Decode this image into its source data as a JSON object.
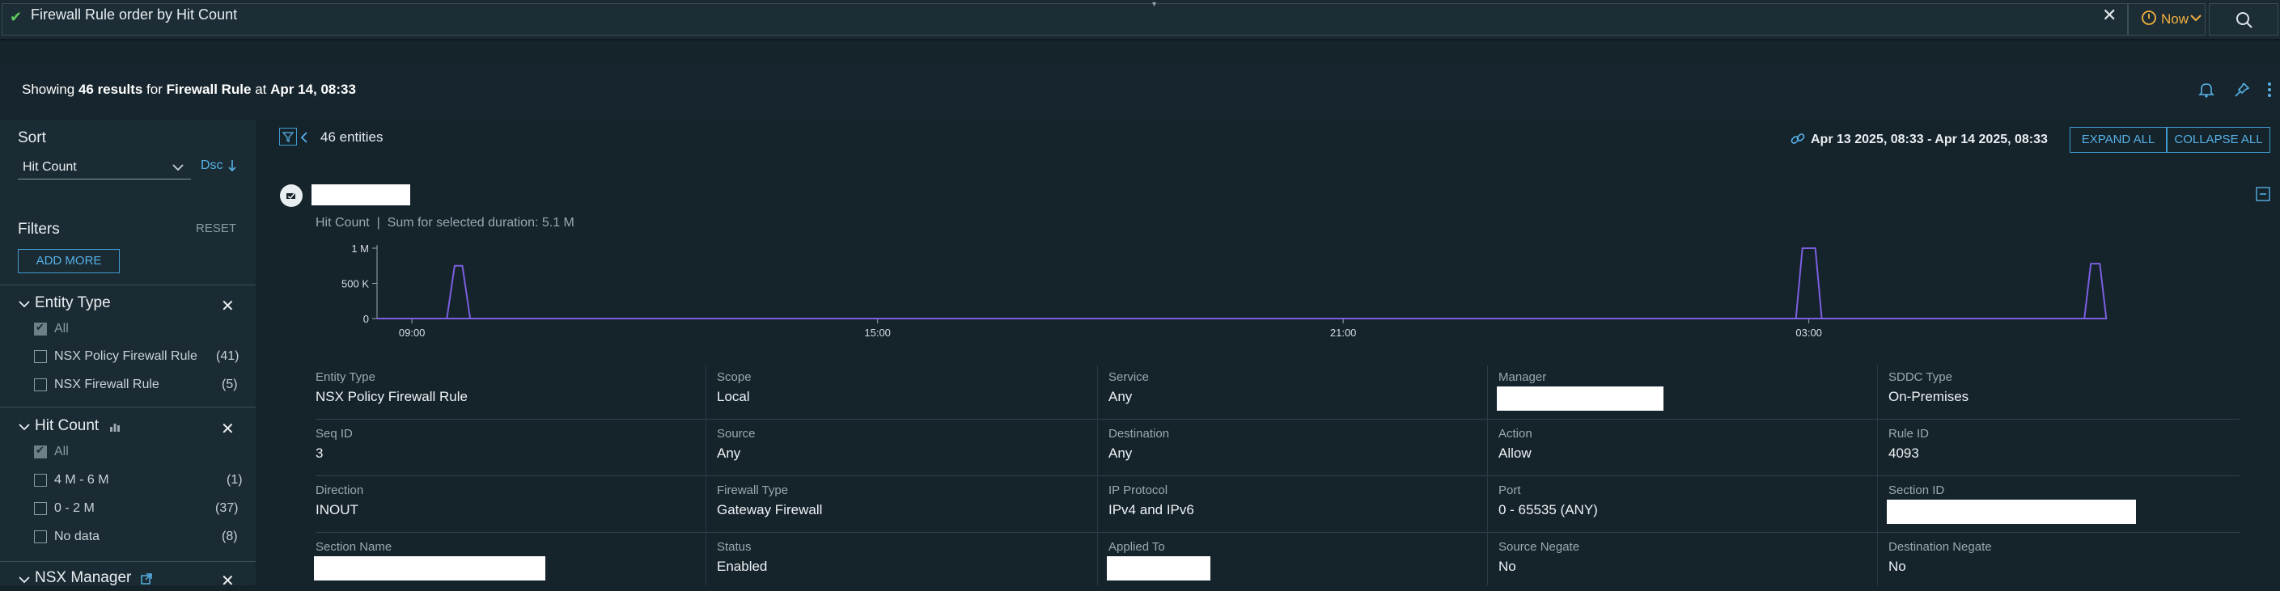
{
  "search": {
    "query": "Firewall Rule order by Hit Count",
    "time_label": "Now"
  },
  "header": {
    "showing_prefix": "Showing ",
    "count": "46 results",
    "for_text": " for ",
    "entity": "Firewall Rule",
    "at_text": " at ",
    "timestamp": "Apr 14, 08:33"
  },
  "sidebar": {
    "sort_title": "Sort",
    "sort_value": "Hit Count",
    "sort_order": "Dsc",
    "filters_title": "Filters",
    "reset_label": "RESET",
    "add_more_label": "ADD MORE",
    "entity_type": {
      "title": "Entity Type",
      "all_label": "All",
      "items": [
        {
          "label": "NSX Policy Firewall Rule",
          "count": "(41)"
        },
        {
          "label": "NSX Firewall Rule",
          "count": "(5)"
        }
      ]
    },
    "hit_count": {
      "title": "Hit Count",
      "all_label": "All",
      "items": [
        {
          "label": "4 M - 6 M",
          "count": "(1)"
        },
        {
          "label": "0 - 2 M",
          "count": "(37)"
        },
        {
          "label": "No data",
          "count": "(8)"
        }
      ]
    },
    "nsx_manager": {
      "title": "NSX Manager"
    }
  },
  "main": {
    "entities_count": "46 entities",
    "time_range": "Apr 13 2025, 08:33 - Apr 14 2025, 08:33",
    "expand_all": "EXPAND ALL",
    "collapse_all": "COLLAPSE ALL",
    "metric_name": "Hit Count",
    "metric_sep": "|",
    "metric_summary": "Sum for selected duration: 5.1 M"
  },
  "chart_data": {
    "type": "line",
    "title": "",
    "xlabel": "",
    "ylabel": "",
    "x_ticks": [
      "09:00",
      "15:00",
      "21:00",
      "03:00"
    ],
    "y_ticks": [
      "0",
      "500 K",
      "1 M"
    ],
    "ylim": [
      0,
      1000000
    ],
    "series": [
      {
        "color": "#7b5fe0",
        "points": [
          [
            "08:33",
            0
          ],
          [
            "09:27",
            0
          ],
          [
            "09:33",
            750000
          ],
          [
            "09:39",
            750000
          ],
          [
            "09:45",
            0
          ],
          [
            "02:50",
            0
          ],
          [
            "02:55",
            1000000
          ],
          [
            "03:05",
            1000000
          ],
          [
            "03:10",
            0
          ],
          [
            "06:33",
            0
          ],
          [
            "06:38",
            780000
          ],
          [
            "06:45",
            780000
          ],
          [
            "06:50",
            0
          ],
          [
            "08:33",
            0
          ]
        ]
      }
    ]
  },
  "details": {
    "rows": [
      [
        {
          "label": "Entity Type",
          "value": "NSX Policy Firewall Rule"
        },
        {
          "label": "Scope",
          "value": "Local"
        },
        {
          "label": "Service",
          "value": "Any"
        },
        {
          "label": "Manager",
          "value": ""
        },
        {
          "label": "SDDC Type",
          "value": "On-Premises"
        }
      ],
      [
        {
          "label": "Seq ID",
          "value": "3"
        },
        {
          "label": "Source",
          "value": "Any"
        },
        {
          "label": "Destination",
          "value": "Any"
        },
        {
          "label": "Action",
          "value": "Allow"
        },
        {
          "label": "Rule ID",
          "value": "4093"
        }
      ],
      [
        {
          "label": "Direction",
          "value": "INOUT"
        },
        {
          "label": "Firewall Type",
          "value": "Gateway Firewall"
        },
        {
          "label": "IP Protocol",
          "value": "IPv4 and IPv6"
        },
        {
          "label": "Port",
          "value": "0 - 65535 (ANY)"
        },
        {
          "label": "Section ID",
          "value": ""
        }
      ],
      [
        {
          "label": "Section Name",
          "value": ""
        },
        {
          "label": "Status",
          "value": "Enabled"
        },
        {
          "label": "Applied To",
          "value": ""
        },
        {
          "label": "Source Negate",
          "value": "No"
        },
        {
          "label": "Destination Negate",
          "value": "No"
        }
      ]
    ]
  }
}
